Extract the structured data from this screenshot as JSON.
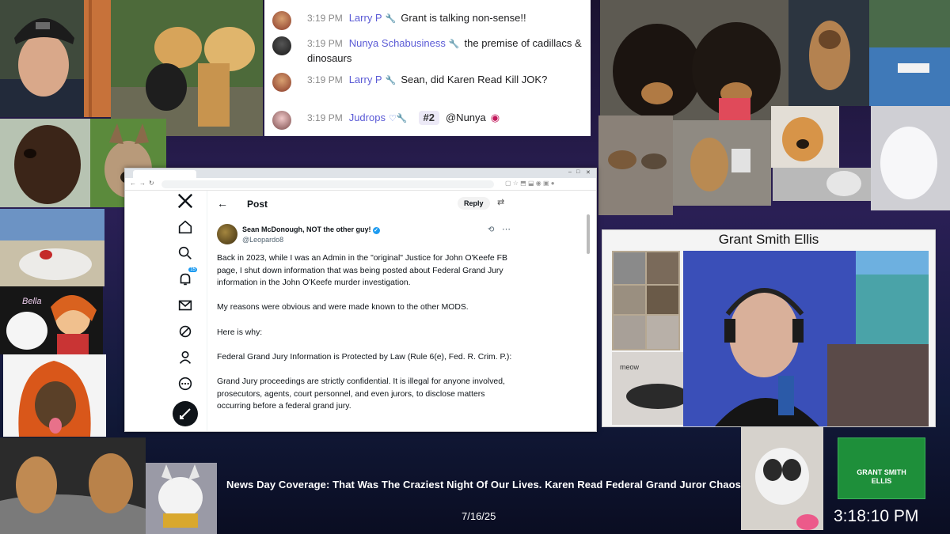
{
  "chat": {
    "messages": [
      {
        "time": "3:19 PM",
        "user": "Larry P",
        "badge": "",
        "text": "Grant is talking non-sense!!"
      },
      {
        "time": "3:19 PM",
        "user": "Nunya Schabusiness",
        "badge": "",
        "text": "the premise of cadillacs & dinosaurs"
      },
      {
        "time": "3:19 PM",
        "user": "Larry P",
        "badge": "",
        "text": "Sean, did Karen Read Kill JOK?"
      },
      {
        "time": "3:19 PM",
        "user": "Judrops",
        "badge": "#2",
        "text": "@Nunya"
      }
    ]
  },
  "browser": {
    "header_title": "Post",
    "reply_label": "Reply",
    "notification_count": "15",
    "author_name": "Sean McDonough, NOT the other guy!",
    "author_handle": "@Leopardo8",
    "paragraphs": [
      "Back in 2023, while I was an Admin in the \"original\" Justice for John O'Keefe FB page, I shut down information that was being posted about Federal Grand Jury information in the John O'Keefe murder investigation.",
      "My reasons were obvious and were made known to the other MODS.",
      "Here is why:",
      "Federal Grand Jury Information is Protected by Law (Rule 6(e), Fed. R. Crim. P.):",
      "Grand Jury proceedings are strictly confidential. It is illegal for anyone involved, prosecutors, agents, court personnel, and even jurors, to disclose matters occurring before a federal grand jury."
    ]
  },
  "panel": {
    "title": "Grant Smith Ellis",
    "cat_caption": "meow"
  },
  "photo_labels": {
    "bella": "Bella"
  },
  "logo": {
    "main": "GRANT SMITH",
    "second": "ELLIS"
  },
  "banner": {
    "headline": "News Day Coverage: That Was The Craziest Night Of Our Lives. Karen Read Federal Grand Juror Chaos",
    "date": "7/16/25",
    "clock": "3:18:10 PM"
  },
  "colors": {
    "chat_name": "#5b5bd6",
    "x_blue": "#1d9bf0",
    "logo_green": "#1e8f3a"
  }
}
